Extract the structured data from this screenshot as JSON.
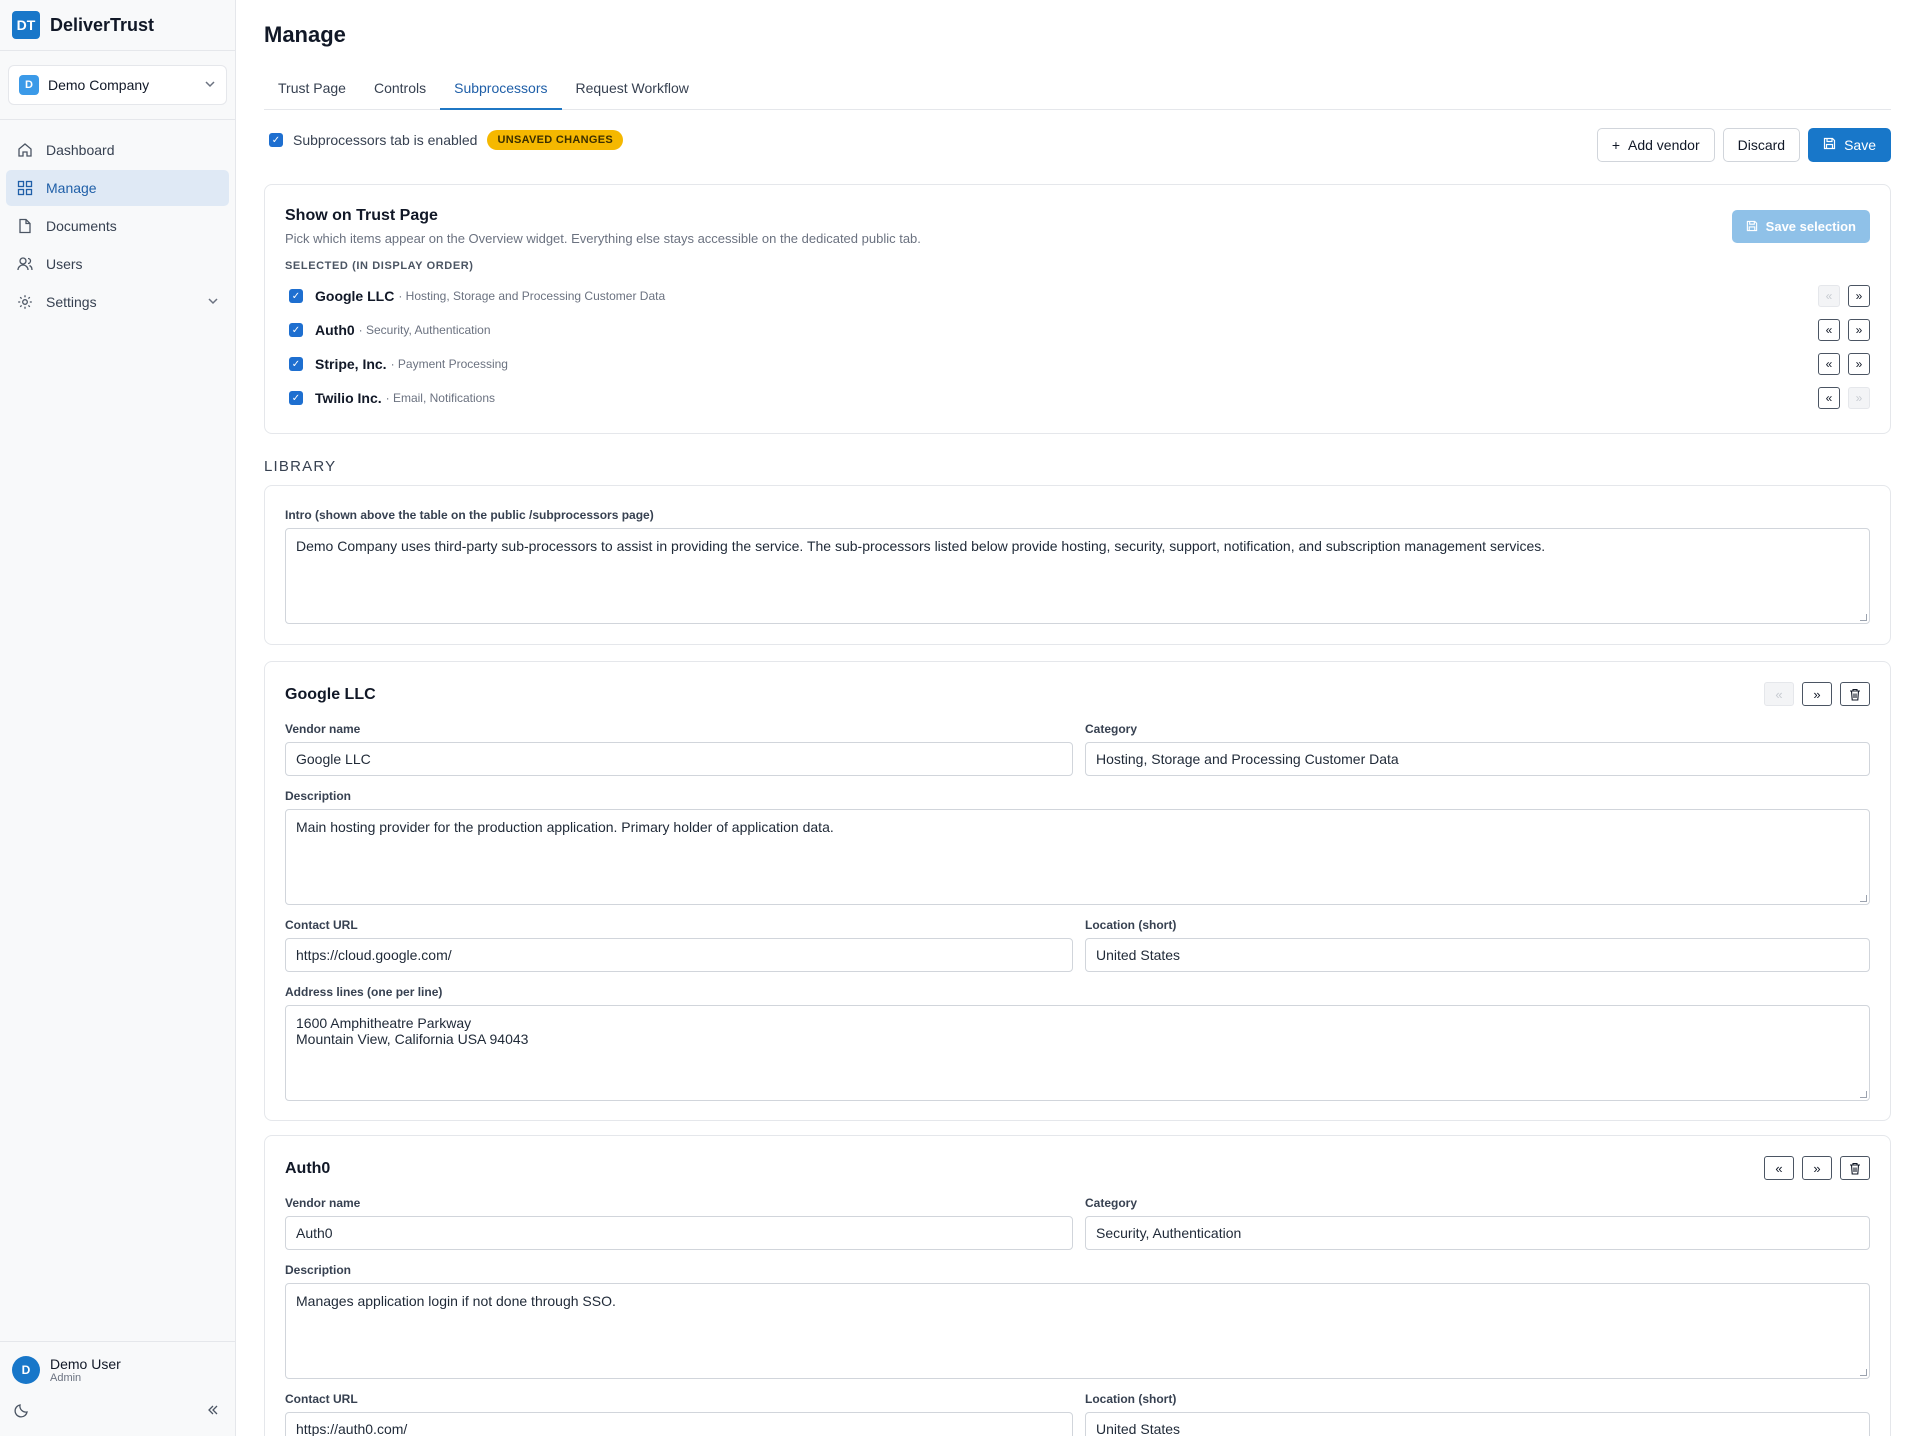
{
  "app": {
    "logo_text": "DT",
    "name": "DeliverTrust"
  },
  "company": {
    "badge": "D",
    "name": "Demo Company"
  },
  "nav": [
    {
      "label": "Dashboard",
      "icon": "home-icon"
    },
    {
      "label": "Manage",
      "icon": "grid-icon",
      "active": true
    },
    {
      "label": "Documents",
      "icon": "document-icon"
    },
    {
      "label": "Users",
      "icon": "users-icon"
    },
    {
      "label": "Settings",
      "icon": "gear-icon"
    }
  ],
  "user": {
    "initial": "D",
    "name": "Demo User",
    "role": "Admin"
  },
  "page": {
    "title": "Manage"
  },
  "tabs": [
    "Trust Page",
    "Controls",
    "Subprocessors",
    "Request Workflow"
  ],
  "active_tab": "Subprocessors",
  "toolbar": {
    "enabled_label": "Subprocessors tab is enabled",
    "badge": "UNSAVED CHANGES",
    "add_vendor": "Add vendor",
    "discard": "Discard",
    "save": "Save"
  },
  "show_on_trust": {
    "title": "Show on Trust Page",
    "description": "Pick which items appear on the Overview widget. Everything else stays accessible on the dedicated public tab.",
    "selected_heading": "SELECTED (IN DISPLAY ORDER)",
    "save_selection": "Save selection",
    "items": [
      {
        "name": "Google LLC",
        "category": "· Hosting, Storage and Processing Customer Data"
      },
      {
        "name": "Auth0",
        "category": "· Security, Authentication"
      },
      {
        "name": "Stripe, Inc.",
        "category": "· Payment Processing"
      },
      {
        "name": "Twilio Inc.",
        "category": "· Email, Notifications"
      }
    ]
  },
  "library": {
    "heading": "LIBRARY",
    "intro_label": "Intro (shown above the table on the public /subprocessors page)",
    "intro_text": "Demo Company uses third-party sub-processors to assist in providing the service. The sub-processors listed below provide hosting, security, support, notification, and subscription management services."
  },
  "field_labels": {
    "vendor_name": "Vendor name",
    "category": "Category",
    "description": "Description",
    "contact_url": "Contact URL",
    "location": "Location (short)",
    "address": "Address lines (one per line)"
  },
  "vendors": [
    {
      "title": "Google LLC",
      "vendor_name": "Google LLC",
      "category": "Hosting, Storage and Processing Customer Data",
      "description": "Main hosting provider for the production application. Primary holder of application data.",
      "contact_url": "https://cloud.google.com/",
      "location": "United States",
      "address": "1600 Amphitheatre Parkway\nMountain View, California USA 94043"
    },
    {
      "title": "Auth0",
      "vendor_name": "Auth0",
      "category": "Security, Authentication",
      "description": "Manages application login if not done through SSO.",
      "contact_url": "https://auth0.com/",
      "location": "United States"
    }
  ]
}
